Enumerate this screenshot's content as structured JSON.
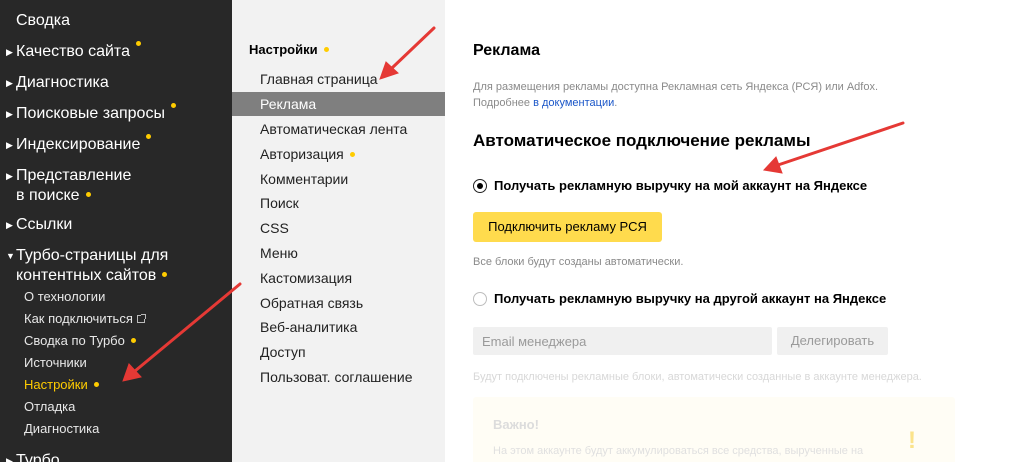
{
  "sidebar": {
    "items": [
      {
        "label": "Сводка",
        "arrow": false,
        "dot": false
      },
      {
        "label": "Качество сайта",
        "arrow": true,
        "dot": true
      },
      {
        "label": "Диагностика",
        "arrow": true,
        "dot": false
      },
      {
        "label": "Поисковые запросы",
        "arrow": true,
        "dot": true
      },
      {
        "label": "Индексирование",
        "arrow": true,
        "dot": true
      },
      {
        "label_line1": "Представление",
        "label_line2": "в поиске",
        "arrow": true,
        "dot": true
      },
      {
        "label": "Ссылки",
        "arrow": true,
        "dot": false
      },
      {
        "label_line1": "Турбо-страницы для",
        "label_line2": "контентных сайтов",
        "arrow": true,
        "expanded": true,
        "dot": true
      },
      {
        "label": "Турбо",
        "arrow": true,
        "dot": false
      }
    ],
    "subitems": [
      {
        "label": "О технологии"
      },
      {
        "label": "Как подключиться",
        "external": true
      },
      {
        "label": "Сводка по Турбо",
        "dot": true
      },
      {
        "label": "Источники"
      },
      {
        "label": "Настройки",
        "active": true,
        "dot": true
      },
      {
        "label": "Отладка"
      },
      {
        "label": "Диагностика"
      }
    ]
  },
  "settings_menu": {
    "title": "Настройки",
    "items": [
      {
        "label": "Главная страница"
      },
      {
        "label": "Реклама",
        "active": true
      },
      {
        "label": "Автоматическая лента"
      },
      {
        "label": "Авторизация",
        "dot": true
      },
      {
        "label": "Комментарии"
      },
      {
        "label": "Поиск"
      },
      {
        "label": "CSS"
      },
      {
        "label": "Меню"
      },
      {
        "label": "Кастомизация"
      },
      {
        "label": "Обратная связь"
      },
      {
        "label": "Веб-аналитика"
      },
      {
        "label": "Доступ"
      },
      {
        "label": "Пользоват. соглашение"
      }
    ]
  },
  "main": {
    "title": "Реклама",
    "desc_line1": "Для размещения рекламы доступна Рекламная сеть Яндекса (РСЯ) или Adfox.",
    "desc_line2_prefix": "Подробнее ",
    "desc_link": "в документации",
    "desc_line2_suffix": ".",
    "section_title": "Автоматическое подключение рекламы",
    "option_own": "Получать рекламную выручку на мой аккаунт на Яндексе",
    "connect_button": "Подключить рекламу РСЯ",
    "auto_note": "Все блоки будут созданы автоматически.",
    "option_other": "Получать рекламную выручку на другой аккаунт на Яндексе",
    "email_placeholder": "Email менеджера",
    "delegate_button": "Делегировать",
    "manager_note": "Будут подключены рекламные блоки, автоматически созданные в аккаунте менеджера.",
    "important_title": "Важно!",
    "important_text": "На этом аккаунте будут аккумулироваться все средства, вырученные на",
    "important_icon": "!"
  },
  "colors": {
    "sidebar_bg": "#282828",
    "accent_yellow": "#ffcc00",
    "button_yellow": "#ffdb4d",
    "menu_bg": "#f2f2f2",
    "menu_active": "#7f7f7f",
    "link": "#1a56c8",
    "annotation_red": "#e53935"
  }
}
